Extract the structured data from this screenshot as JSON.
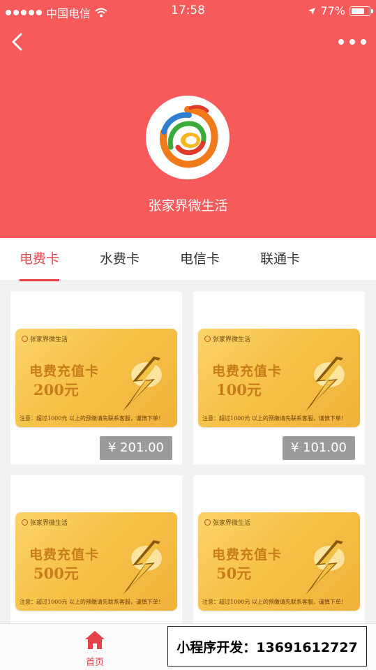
{
  "statusbar": {
    "carrier": "中国电信",
    "time": "17:58",
    "battery": "77%",
    "battery_level": 0.77
  },
  "header": {
    "shop_name": "张家界微生活"
  },
  "tabs": [
    {
      "label": "电费卡",
      "active": true
    },
    {
      "label": "水费卡",
      "active": false
    },
    {
      "label": "电信卡",
      "active": false
    },
    {
      "label": "联通卡",
      "active": false
    }
  ],
  "products": [
    {
      "brand": "张家界微生活",
      "card_title": "电费充值卡",
      "amount": "200元",
      "note": "注意：超过1000元 以上的预缴请先联系客服，谨慎下单！",
      "price": "¥ 201.00"
    },
    {
      "brand": "张家界微生活",
      "card_title": "电费充值卡",
      "amount": "100元",
      "note": "注意：超过1000元 以上的预缴请先联系客服，谨慎下单！",
      "price": "¥ 101.00"
    },
    {
      "brand": "张家界微生活",
      "card_title": "电费充值卡",
      "amount": "500元",
      "note": "注意：超过1000元 以上的预缴请先联系客服，谨慎下单！",
      "price": ""
    },
    {
      "brand": "张家界微生活",
      "card_title": "电费充值卡",
      "amount": "50元",
      "note": "注意：超过1000元 以上的预缴请先联系客服，谨慎下单！",
      "price": ""
    }
  ],
  "bottom_nav": {
    "home_label": "首页",
    "second_label": ""
  },
  "overlay": {
    "ad_text": "小程序开发：13691612727"
  },
  "colors": {
    "header": "#f65a5a",
    "accent": "#e5424b",
    "price_bg": "#9b9b9b",
    "card_gold": "#f6c247"
  },
  "icons": {
    "back": "chevron-left-icon",
    "more": "more-dots-icon",
    "home": "home-icon",
    "wifi": "wifi-icon",
    "location": "location-arrow-icon"
  }
}
